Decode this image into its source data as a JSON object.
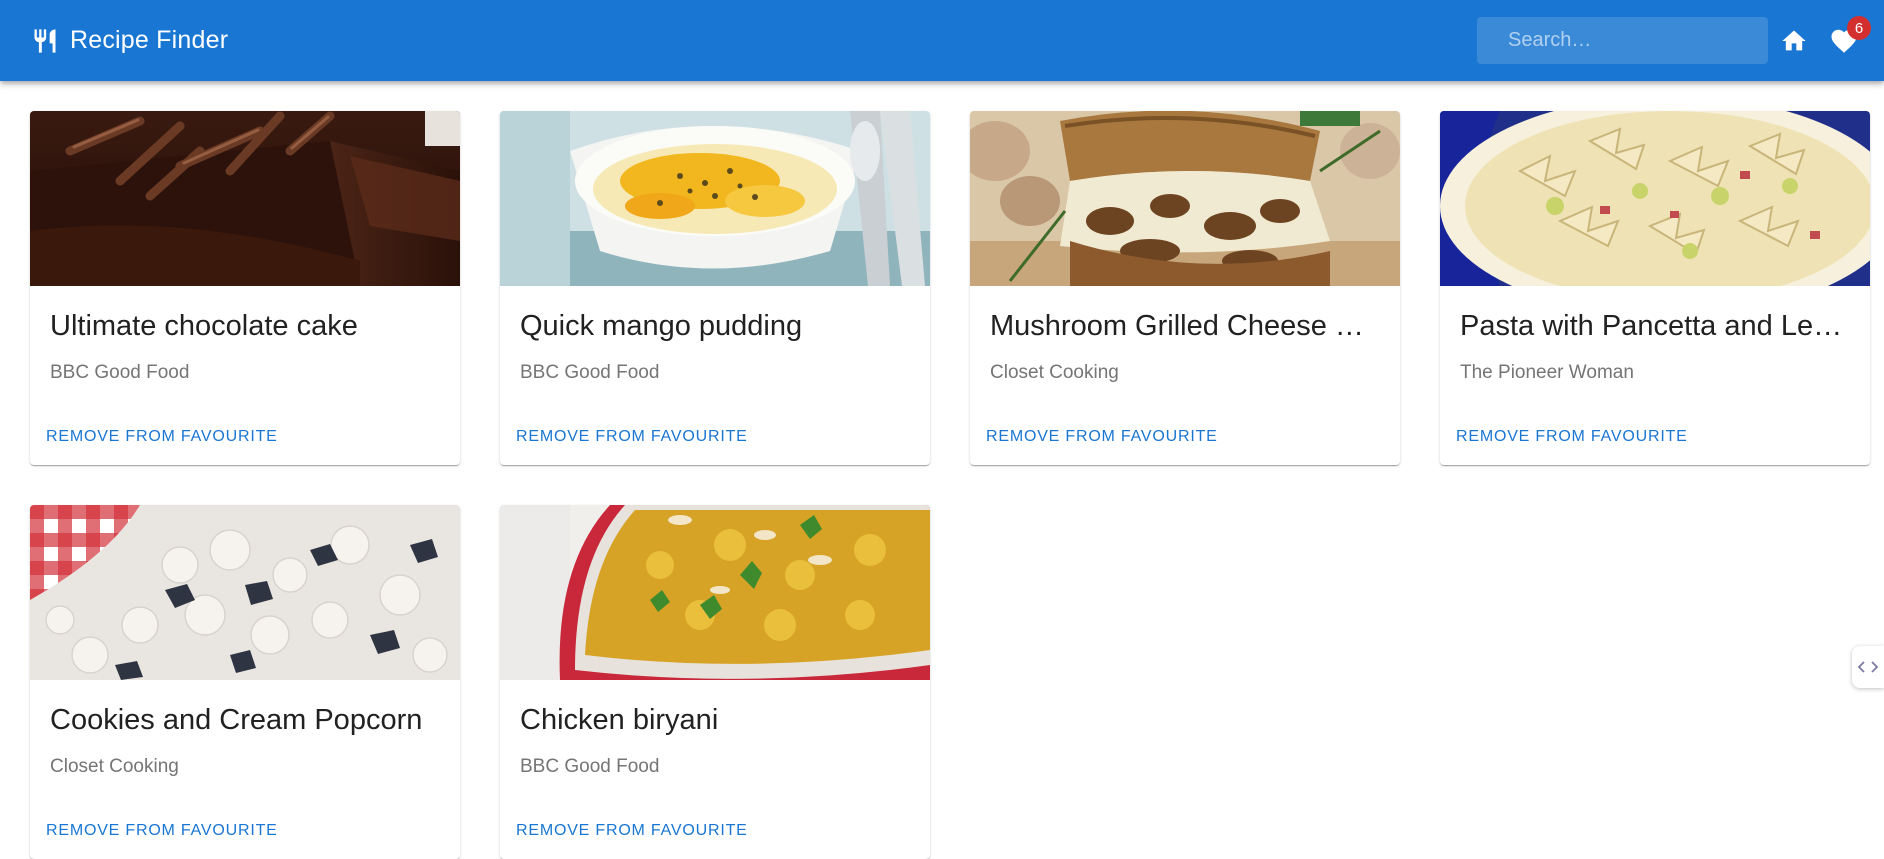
{
  "app": {
    "title": "Recipe Finder",
    "brand_icon": "fork-knife-icon"
  },
  "search": {
    "placeholder": "Search…",
    "value": ""
  },
  "nav": {
    "home_icon": "home-icon",
    "favourites_icon": "heart-icon",
    "favourites_count": "6"
  },
  "colors": {
    "primary": "#1976d2",
    "badge": "#d32f2f"
  },
  "recipes": [
    {
      "title": "Ultimate chocolate cake",
      "source": "BBC Good Food",
      "action": "Remove from favourite",
      "image": "chocolate-cake-photo"
    },
    {
      "title": "Quick mango pudding",
      "source": "BBC Good Food",
      "action": "Remove from favourite",
      "image": "mango-pudding-photo"
    },
    {
      "title": "Mushroom Grilled Cheese Sandwich",
      "source": "Closet Cooking",
      "action": "Remove from favourite",
      "image": "mushroom-grilled-cheese-photo"
    },
    {
      "title": "Pasta with Pancetta and Leeks",
      "source": "The Pioneer Woman",
      "action": "Remove from favourite",
      "image": "pasta-pancetta-photo"
    },
    {
      "title": "Cookies and Cream Popcorn",
      "source": "Closet Cooking",
      "action": "Remove from favourite",
      "image": "cookies-cream-popcorn-photo"
    },
    {
      "title": "Chicken biryani",
      "source": "BBC Good Food",
      "action": "Remove from favourite",
      "image": "chicken-biryani-photo"
    }
  ]
}
